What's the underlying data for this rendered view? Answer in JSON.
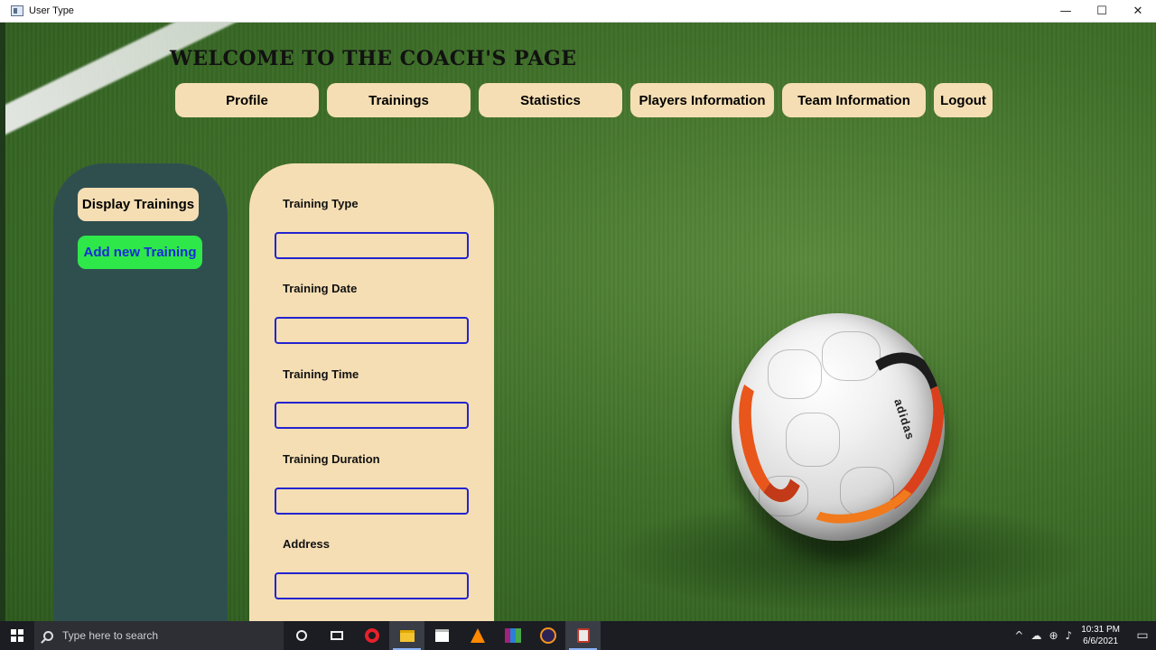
{
  "window": {
    "title": "User Type",
    "minimize": "—",
    "maximize": "☐",
    "close": "✕"
  },
  "header": {
    "title": "WELCOME TO THE COACH'S PAGE"
  },
  "nav": [
    {
      "label": "Profile"
    },
    {
      "label": "Trainings"
    },
    {
      "label": "Statistics"
    },
    {
      "label": "Players Information"
    },
    {
      "label": "Team Information"
    },
    {
      "label": "Logout"
    }
  ],
  "sidebar": {
    "display_label": "Display Trainings",
    "add_label": "Add new Training"
  },
  "form": {
    "fields": [
      {
        "label": "Training Type",
        "value": ""
      },
      {
        "label": "Training Date",
        "value": ""
      },
      {
        "label": "Training Time",
        "value": ""
      },
      {
        "label": "Training Duration",
        "value": ""
      },
      {
        "label": "Address",
        "value": ""
      }
    ]
  },
  "ball": {
    "brand": "adidas"
  },
  "taskbar": {
    "search_placeholder": "Type here to search",
    "time": "10:31 PM",
    "date": "6/6/2021",
    "icons": [
      "cortana-icon",
      "task-view-icon",
      "opera-icon",
      "file-explorer-icon",
      "store-icon",
      "vlc-icon",
      "winrar-icon",
      "eclipse-icon",
      "java-icon"
    ]
  },
  "colors": {
    "panel": "#f5deb3",
    "sidebar": "#2f4f4f",
    "add_button": "#2ee84a",
    "add_text": "#1a2bd6",
    "input_border": "#2323d0"
  }
}
